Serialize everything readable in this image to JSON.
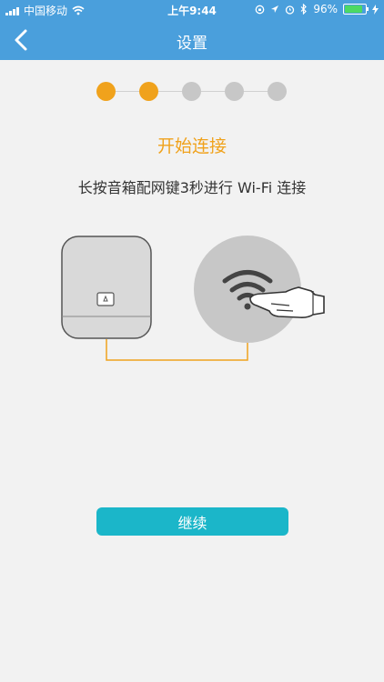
{
  "status_bar": {
    "carrier": "中国移动",
    "time": "上午9:44",
    "battery": "96%",
    "battery_level": 0.96
  },
  "navbar": {
    "title": "设置",
    "back_icon": "chevron-left-icon"
  },
  "steps": {
    "total": 5,
    "completed": 2,
    "active_color": "#f0a21c",
    "inactive_color": "#c7c7c7"
  },
  "content": {
    "heading": "开始连接",
    "instruction": "长按音箱配网键3秒进行 Wi-Fi 连接"
  },
  "colors": {
    "header": "#4a9fdc",
    "accent": "#f0a21c",
    "button": "#1bb6c9"
  },
  "actions": {
    "continue_label": "继续"
  }
}
